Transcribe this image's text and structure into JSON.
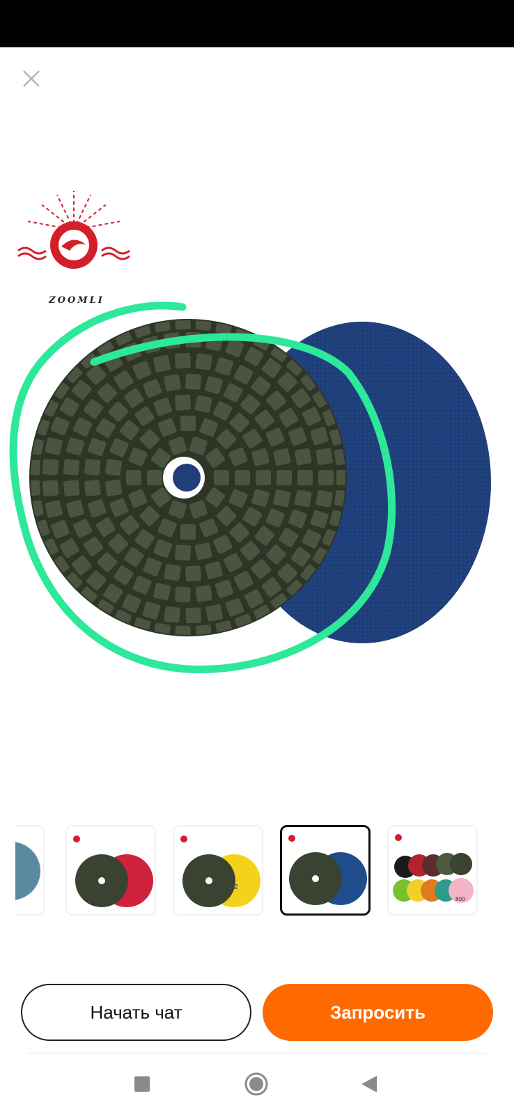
{
  "window": {
    "close_icon": "close-icon"
  },
  "product_image": {
    "brand_text": "ZOOMLI",
    "front_pad_color": "#3a4331",
    "back_pad_color": "#1f3f7a",
    "highlight_color": "#2ee89a"
  },
  "thumbnails": [
    {
      "name": "partial-grey-pad",
      "back_color": "#5a8aa0",
      "selected": false
    },
    {
      "name": "red-pad",
      "back_color": "#d0223a",
      "selected": false
    },
    {
      "name": "yellow-pad",
      "back_color": "#f4d21c",
      "label": "2",
      "selected": false
    },
    {
      "name": "blue-pad",
      "back_color": "#1f4c8a",
      "selected": true
    },
    {
      "name": "color-set",
      "back_color": "#f3b4c8",
      "label": "800",
      "selected": false
    }
  ],
  "actions": {
    "chat_label": "Начать чат",
    "request_label": "Запросить",
    "accent_color": "#ff6a00"
  },
  "system_nav": {
    "recent_icon": "square-icon",
    "home_icon": "circle-home-icon",
    "back_icon": "triangle-back-icon"
  }
}
